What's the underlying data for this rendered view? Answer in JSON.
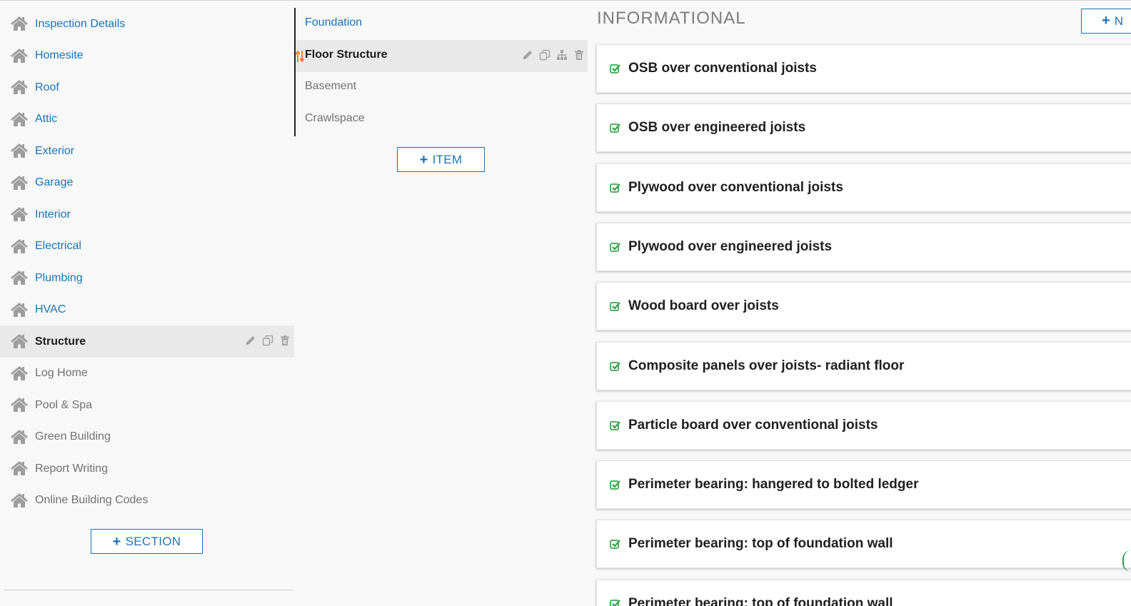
{
  "colors": {
    "link": "#1a73b5",
    "muted": "#707070",
    "active_bg": "#e9e9e9",
    "check_green": "#3aa84f",
    "sort_orange": "#f07b2a"
  },
  "sections": {
    "items": [
      {
        "label": "Inspection Details",
        "state": "link"
      },
      {
        "label": "Homesite",
        "state": "link"
      },
      {
        "label": "Roof",
        "state": "link"
      },
      {
        "label": "Attic",
        "state": "link"
      },
      {
        "label": "Exterior",
        "state": "link"
      },
      {
        "label": "Garage",
        "state": "link"
      },
      {
        "label": "Interior",
        "state": "link"
      },
      {
        "label": "Electrical",
        "state": "link"
      },
      {
        "label": "Plumbing",
        "state": "link"
      },
      {
        "label": "HVAC",
        "state": "link"
      },
      {
        "label": "Structure",
        "state": "active"
      },
      {
        "label": "Log Home",
        "state": "muted"
      },
      {
        "label": "Pool & Spa",
        "state": "muted"
      },
      {
        "label": "Green Building",
        "state": "muted"
      },
      {
        "label": "Report Writing",
        "state": "muted"
      },
      {
        "label": "Online Building Codes",
        "state": "muted"
      }
    ],
    "add_button_label": "SECTION"
  },
  "items": {
    "list": [
      {
        "label": "Foundation",
        "state": "link"
      },
      {
        "label": "Floor Structure",
        "state": "active"
      },
      {
        "label": "Basement",
        "state": "muted"
      },
      {
        "label": "Crawlspace",
        "state": "muted"
      }
    ],
    "add_button_label": "ITEM"
  },
  "comments": {
    "heading": "INFORMATIONAL",
    "new_button_label": "N",
    "cards": [
      "OSB over conventional joists",
      "OSB over engineered joists",
      "Plywood over conventional joists",
      "Plywood over engineered joists",
      "Wood board over joists",
      "Composite panels over joists- radiant floor",
      "Particle board over conventional joists",
      "Perimeter bearing: hangered to bolted ledger",
      "Perimeter bearing: top of foundation wall",
      "Perimeter bearing: top of foundation wall"
    ]
  }
}
